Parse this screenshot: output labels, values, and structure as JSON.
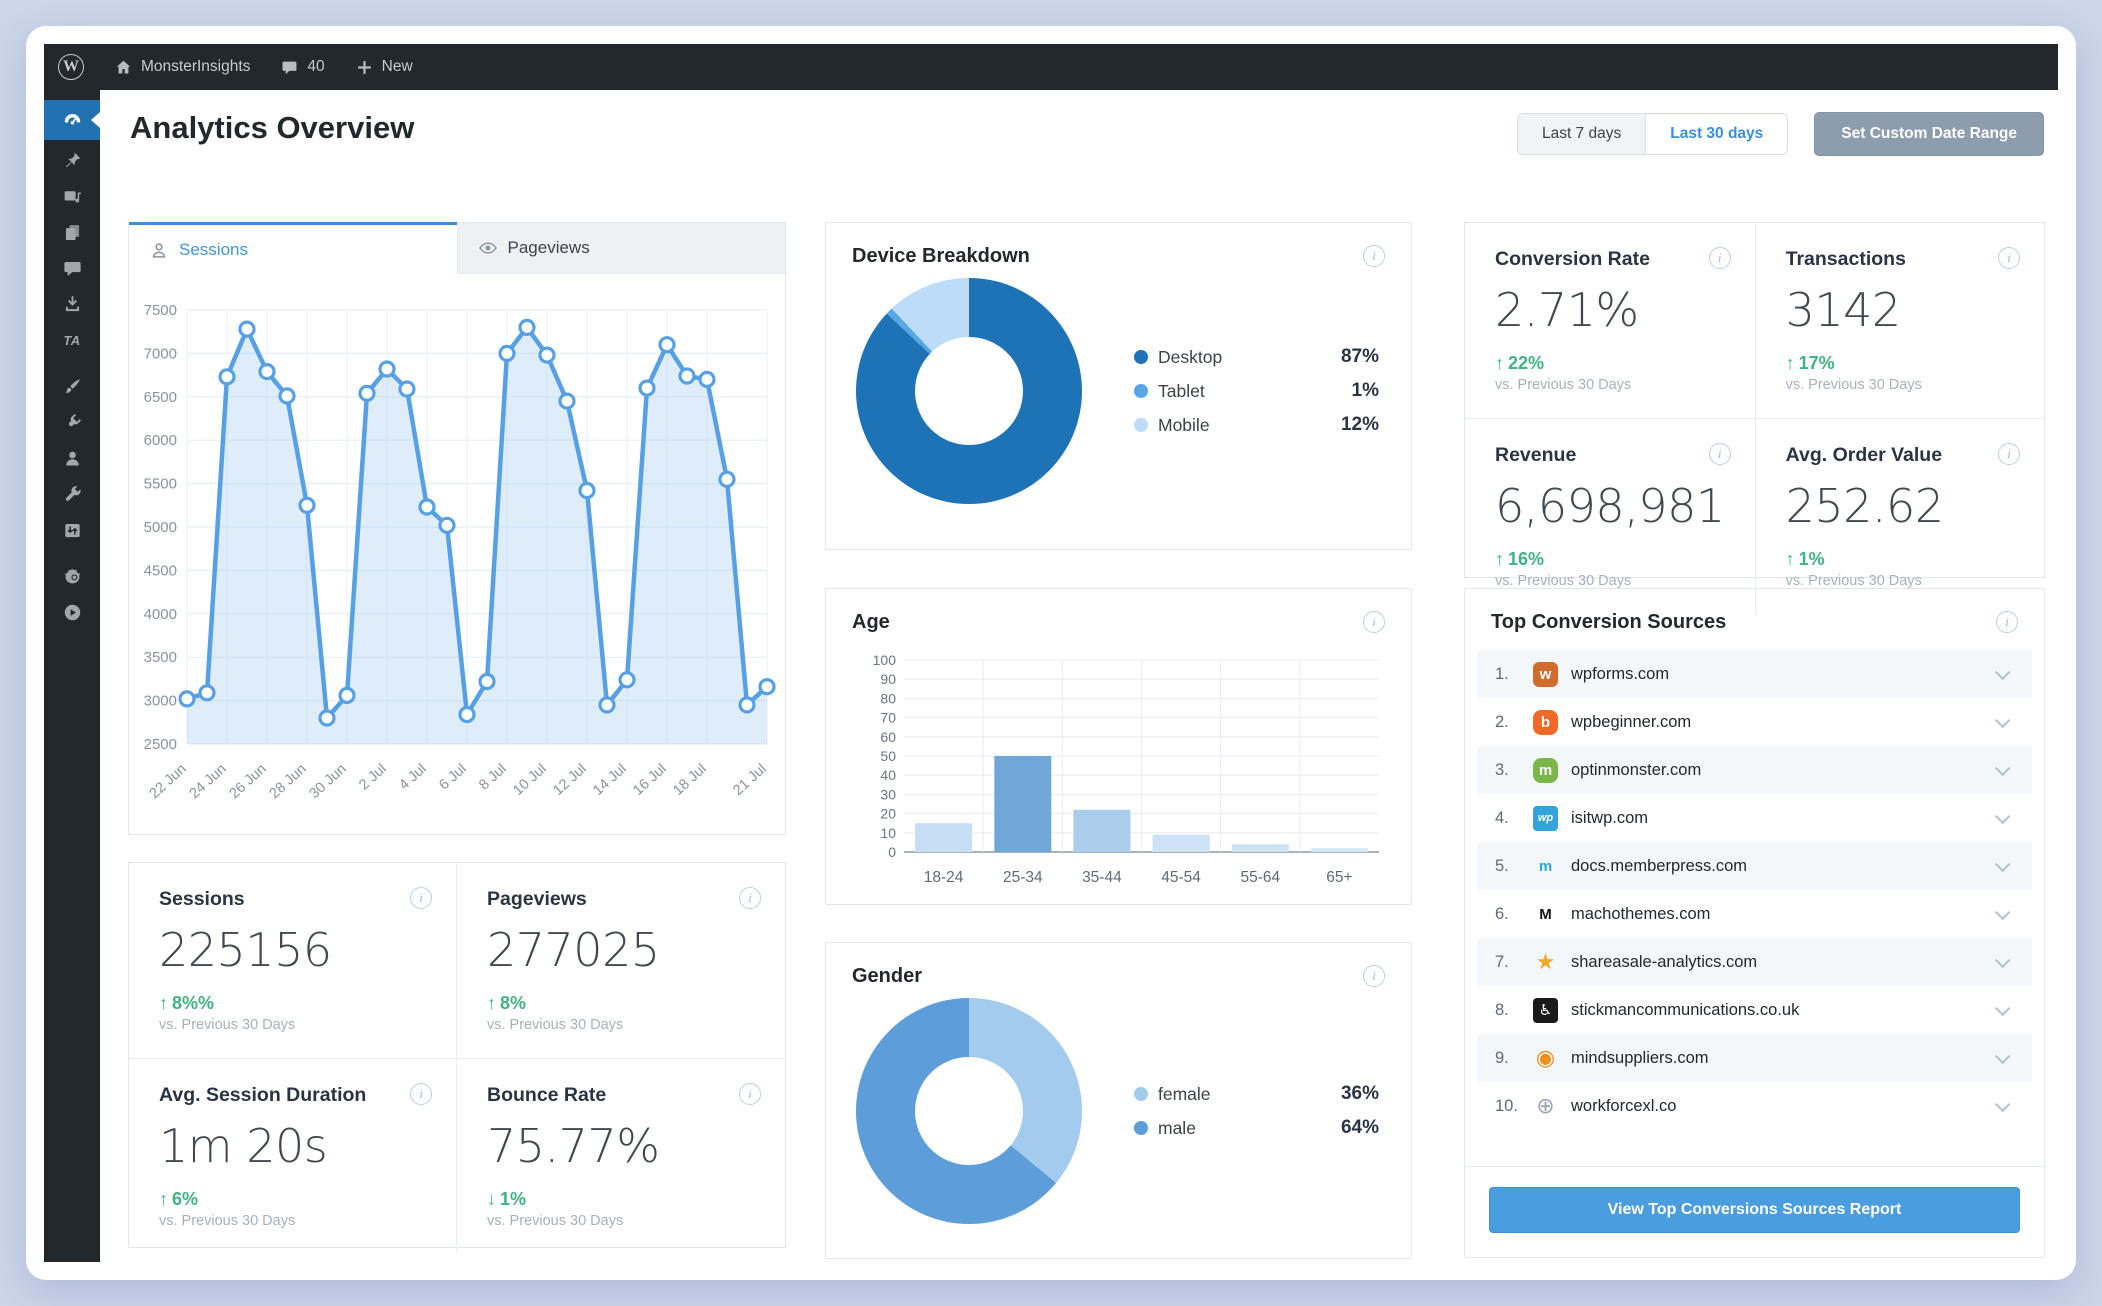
{
  "colors": {
    "outer_background": "#ccd5ea",
    "admin_dark": "#23282d",
    "active_blue": "#2272b1",
    "accent_blue": "#3a8fd9",
    "green_up": "#40b381",
    "panel_border": "#e2e7ec"
  },
  "admin_bar": {
    "wp_logo": "W",
    "site_name": "MonsterInsights",
    "comment_count": "40",
    "new_label": "New"
  },
  "sidebar": {
    "items": [
      {
        "icon": "dashboard-gauge",
        "active": true
      },
      {
        "icon": "pin"
      },
      {
        "icon": "media"
      },
      {
        "icon": "pages"
      },
      {
        "icon": "comments"
      },
      {
        "icon": "download"
      },
      {
        "icon": "ta-logo",
        "text": "TA"
      },
      {
        "icon": "appearance-brush",
        "group_gap": true
      },
      {
        "icon": "plugin"
      },
      {
        "icon": "users"
      },
      {
        "icon": "tools-wrench"
      },
      {
        "icon": "settings-sliders"
      },
      {
        "icon": "mascot",
        "group_gap": true
      },
      {
        "icon": "video-play"
      }
    ]
  },
  "header": {
    "title": "Analytics Overview",
    "range_buttons": [
      {
        "label": "Last 7 days",
        "active": false
      },
      {
        "label": "Last 30 days",
        "active": true
      }
    ],
    "custom_range_label": "Set Custom Date Range"
  },
  "session_chart": {
    "tabs": [
      {
        "label": "Sessions",
        "icon": "person",
        "active": true
      },
      {
        "label": "Pageviews",
        "icon": "eye",
        "active": false
      }
    ]
  },
  "chart_data": [
    {
      "id": "sessions_timeseries",
      "type": "line",
      "title": "Sessions",
      "x_tick_labels": [
        "22 Jun",
        "24 Jun",
        "26 Jun",
        "28 Jun",
        "30 Jun",
        "2 Jul",
        "4 Jul",
        "6 Jul",
        "8 Jul",
        "10 Jul",
        "12 Jul",
        "14 Jul",
        "16 Jul",
        "18 Jul",
        "21 Jul"
      ],
      "x_tick_indices": [
        0,
        2,
        4,
        6,
        8,
        10,
        12,
        14,
        16,
        18,
        20,
        22,
        24,
        26,
        29
      ],
      "values": [
        3020,
        3090,
        6730,
        7280,
        6790,
        6510,
        5250,
        2800,
        3060,
        6540,
        6820,
        6590,
        5230,
        5020,
        2840,
        3220,
        7000,
        7300,
        6980,
        6450,
        5420,
        2950,
        3240,
        6600,
        7100,
        6740,
        6700,
        5550,
        2950,
        3160
      ],
      "ylim": [
        2500,
        7500
      ],
      "y_ticks": [
        2500,
        3000,
        3500,
        4000,
        4500,
        5000,
        5500,
        6000,
        6500,
        7000,
        7500
      ],
      "grid": true,
      "line_color": "#57a0e5",
      "fill_color": "rgba(150,197,240,0.30)"
    },
    {
      "id": "device_breakdown",
      "type": "donut",
      "title": "Device Breakdown",
      "slices": [
        {
          "label": "Desktop",
          "value": 87,
          "display": "87%",
          "color": "#1e73b7"
        },
        {
          "label": "Tablet",
          "value": 1,
          "display": "1%",
          "color": "#57a7e4"
        },
        {
          "label": "Mobile",
          "value": 12,
          "display": "12%",
          "color": "#bcdcf7"
        }
      ]
    },
    {
      "id": "age_distribution",
      "type": "bar",
      "title": "Age",
      "categories": [
        "18-24",
        "25-34",
        "35-44",
        "45-54",
        "55-64",
        "65+"
      ],
      "values": [
        15,
        50,
        22,
        9,
        4,
        2
      ],
      "ylim": [
        0,
        100
      ],
      "y_ticks": [
        0,
        10,
        20,
        30,
        40,
        50,
        60,
        70,
        80,
        90,
        100
      ],
      "bar_colors": [
        "#c7dff4",
        "#6fa8d8",
        "#a9cdeb",
        "#cde2f5",
        "#cde2f5",
        "#d6e8f8"
      ]
    },
    {
      "id": "gender_split",
      "type": "donut",
      "title": "Gender",
      "slices": [
        {
          "label": "female",
          "value": 36,
          "display": "36%",
          "color": "#a3cbee"
        },
        {
          "label": "male",
          "value": 64,
          "display": "64%",
          "color": "#5d9dd8"
        }
      ]
    }
  ],
  "ecommerce_stats": [
    {
      "label": "Conversion Rate",
      "value": "2.71%",
      "delta": "22%",
      "direction": "up",
      "compare": "vs. Previous 30 Days"
    },
    {
      "label": "Transactions",
      "value": "3142",
      "delta": "17%",
      "direction": "up",
      "compare": "vs. Previous 30 Days"
    },
    {
      "label": "Revenue",
      "value": "6,698,981",
      "delta": "16%",
      "direction": "up",
      "compare": "vs. Previous 30 Days"
    },
    {
      "label": "Avg. Order Value",
      "value": "252.62",
      "delta": "1%",
      "direction": "up",
      "compare": "vs. Previous 30 Days"
    }
  ],
  "overview_stats": [
    {
      "label": "Sessions",
      "value": "225156",
      "delta": "8%%",
      "direction": "up",
      "compare": "vs. Previous 30 Days"
    },
    {
      "label": "Pageviews",
      "value": "277025",
      "delta": "8%",
      "direction": "up",
      "compare": "vs. Previous 30 Days"
    },
    {
      "label": "Avg. Session Duration",
      "value": "1m 20s",
      "delta": "6%",
      "direction": "up",
      "compare": "vs. Previous 30 Days"
    },
    {
      "label": "Bounce Rate",
      "value": "75.77%",
      "delta": "1%",
      "direction": "down",
      "compare": "vs. Previous 30 Days"
    }
  ],
  "sources": {
    "title": "Top Conversion Sources",
    "items": [
      {
        "rank": "1.",
        "domain": "wpforms.com",
        "icon": {
          "glyph": "w",
          "bg": "#cf6c2e",
          "color": "#ffffff",
          "radius": "6px"
        }
      },
      {
        "rank": "2.",
        "domain": "wpbeginner.com",
        "icon": {
          "glyph": "b",
          "bg": "#f06929",
          "color": "#ffffff",
          "radius": "8px"
        }
      },
      {
        "rank": "3.",
        "domain": "optinmonster.com",
        "icon": {
          "glyph": "m",
          "bg": "#7ab64a",
          "color": "#ffffff",
          "radius": "8px"
        }
      },
      {
        "rank": "4.",
        "domain": "isitwp.com",
        "icon": {
          "glyph": "wp",
          "bg": "#34a3dc",
          "color": "#ffffff",
          "radius": "4px"
        }
      },
      {
        "rank": "5.",
        "domain": "docs.memberpress.com",
        "icon": {
          "glyph": "m",
          "bg": "transparent",
          "color": "#2da8e0",
          "radius": "0"
        }
      },
      {
        "rank": "6.",
        "domain": "machothemes.com",
        "icon": {
          "glyph": "M",
          "bg": "transparent",
          "color": "#141414",
          "radius": "0"
        }
      },
      {
        "rank": "7.",
        "domain": "shareasale-analytics.com",
        "icon": {
          "glyph": "★",
          "bg": "transparent",
          "color": "#f0a92e",
          "radius": "0"
        }
      },
      {
        "rank": "8.",
        "domain": "stickmancommunications.co.uk",
        "icon": {
          "glyph": "♿",
          "bg": "#1a1a1a",
          "color": "#ffffff",
          "radius": "4px"
        }
      },
      {
        "rank": "9.",
        "domain": "mindsuppliers.com",
        "icon": {
          "glyph": "◉",
          "bg": "transparent",
          "color": "#ef8d1d",
          "radius": "0"
        }
      },
      {
        "rank": "10.",
        "domain": "workforcexl.co",
        "icon": {
          "glyph": "⊕",
          "bg": "transparent",
          "color": "#97a5b3",
          "radius": "0"
        }
      }
    ],
    "button_label": "View Top Conversions Sources Report"
  }
}
